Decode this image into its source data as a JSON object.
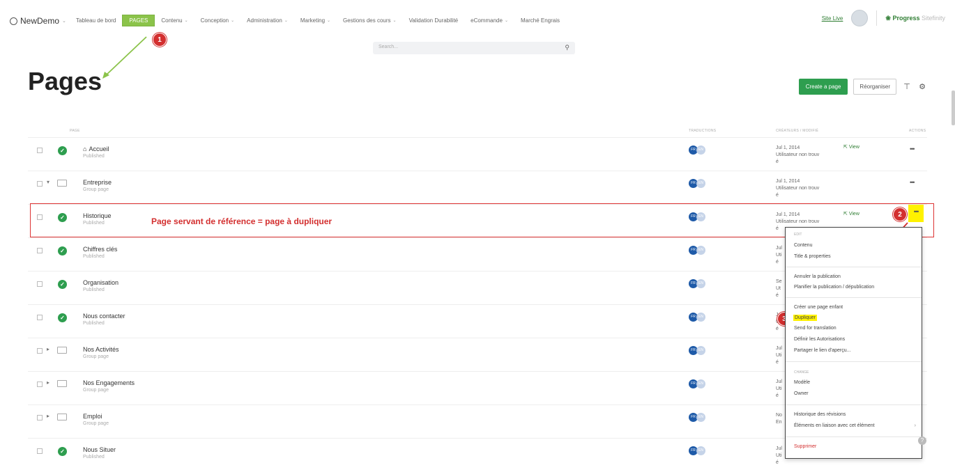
{
  "topbar": {
    "brand": "NewDemo",
    "nav": [
      {
        "label": "Tableau de bord",
        "dropdown": false,
        "active": false
      },
      {
        "label": "PAGES",
        "dropdown": false,
        "active": true
      },
      {
        "label": "Contenu",
        "dropdown": true,
        "active": false
      },
      {
        "label": "Conception",
        "dropdown": true,
        "active": false
      },
      {
        "label": "Administration",
        "dropdown": true,
        "active": false
      },
      {
        "label": "Marketing",
        "dropdown": true,
        "active": false
      },
      {
        "label": "Gestions des cours",
        "dropdown": true,
        "active": false
      },
      {
        "label": "Validation Durabilité",
        "dropdown": false,
        "active": false
      },
      {
        "label": "eCommande",
        "dropdown": true,
        "active": false
      },
      {
        "label": "Marché Engrais",
        "dropdown": false,
        "active": false
      }
    ],
    "site_link": "Site Live",
    "logo": "Progress",
    "logo_suffix": "Sitefinity"
  },
  "search": {
    "placeholder": "Search..."
  },
  "page": {
    "title": "Pages",
    "create_button": "Create a page",
    "reorganize_button": "Réorganiser"
  },
  "columns": {
    "page": "PAGE",
    "translations": "TRADUCTIONS",
    "modified": "CRÉATEURS / MODIFIÉ",
    "actions": "ACTIONS"
  },
  "rows": [
    {
      "name": "Accueil",
      "state": "Published",
      "type": "page",
      "home": true,
      "date": "Jul 1, 2014",
      "author": "Utilisateur non trouv",
      "author2": "é",
      "view": "View"
    },
    {
      "name": "Entreprise",
      "state": "Group page",
      "type": "group",
      "expander": "▾",
      "date": "Jul 1, 2014",
      "author": "Utilisateur non trouv",
      "author2": "é"
    },
    {
      "name": "Historique",
      "state": "Published",
      "type": "page",
      "date": "Jul 1, 2014",
      "author": "Utilisateur non trouv",
      "author2": "é",
      "view": "View",
      "highlight": true
    },
    {
      "name": "Chiffres clés",
      "state": "Published",
      "type": "page",
      "date": "Jul",
      "author": "Uti",
      "author2": "é"
    },
    {
      "name": "Organisation",
      "state": "Published",
      "type": "page",
      "date": "Se",
      "author": "Ut",
      "author2": "é"
    },
    {
      "name": "Nous contacter",
      "state": "Published",
      "type": "page",
      "date": "Jul",
      "author": "Uti",
      "author2": "é"
    },
    {
      "name": "Nos Activités",
      "state": "Group page",
      "type": "group",
      "expander": "▸",
      "date": "Jul",
      "author": "Uti",
      "author2": "é"
    },
    {
      "name": "Nos Engagements",
      "state": "Group page",
      "type": "group",
      "expander": "▸",
      "date": "Jul",
      "author": "Uti",
      "author2": "é"
    },
    {
      "name": "Emploi",
      "state": "Group page",
      "type": "group",
      "expander": "▸",
      "date": "No",
      "author": "En",
      "author2": ""
    },
    {
      "name": "Nous Situer",
      "state": "Published",
      "type": "page",
      "date": "Jul",
      "author": "Uti",
      "author2": "é"
    }
  ],
  "lang_badges": [
    "FR",
    "EN"
  ],
  "annotations": {
    "label": "Page servant de référence = page à dupliquer",
    "badge1": "1",
    "badge2": "2",
    "badge3": "3"
  },
  "context_menu": {
    "hdr1": "Edit",
    "contenu": "Contenu",
    "title_props": "Title & properties",
    "unpublish": "Annuler la publication",
    "schedule": "Planifier la publication / dépublication",
    "create_child": "Créer une page enfant",
    "duplicate": "Dupliquer",
    "send_translation": "Send for translation",
    "permissions": "Définir les Autorisations",
    "share_preview": "Partager le lien d'aperçu...",
    "hdr2": "Change",
    "template": "Modèle",
    "owner": "Owner",
    "history": "Historique des révisions",
    "related": "Éléments en liaison avec cet élément",
    "delete": "Supprimer"
  },
  "colors": {
    "accent": "#2e9e4f",
    "nav_active": "#8bc34a",
    "annotation": "#d32f2f",
    "highlight": "#fff200"
  }
}
